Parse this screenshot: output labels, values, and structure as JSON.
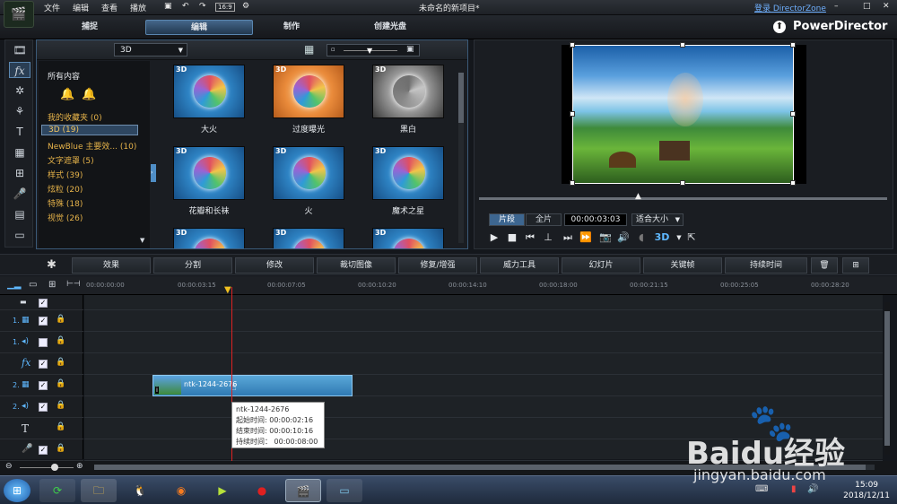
{
  "menu": {
    "file": "文件",
    "edit": "编辑",
    "view": "查看",
    "play": "播放"
  },
  "window_title": "未命名的新项目*",
  "login_link": "登录 DirectorZone",
  "tabs": {
    "capture": "捕捉",
    "edit": "编辑",
    "produce": "制作",
    "disc": "创建光盘"
  },
  "brand": "PowerDirector",
  "library": {
    "dropdown": "3D",
    "categories_header": "所有内容",
    "categories": [
      {
        "label": "我的收藏夹 (0)"
      },
      {
        "label": "3D (19)"
      },
      {
        "label": "NewBlue 主要效... (10)"
      },
      {
        "label": "文字遮罩 (5)"
      },
      {
        "label": "样式 (39)"
      },
      {
        "label": "炫粒 (20)"
      },
      {
        "label": "特殊 (18)"
      },
      {
        "label": "视觉 (26)"
      }
    ],
    "badge": "3D",
    "effects": [
      "大火",
      "过度曝光",
      "黑白",
      "花瓣和长袜",
      "火",
      "魔术之星"
    ]
  },
  "preview": {
    "clip_tab": "片段",
    "full_tab": "全片",
    "timecode": "00:00:03:03",
    "fit": "适合大小",
    "three_d": "3D"
  },
  "actions": [
    "效果",
    "分割",
    "修改",
    "裁切图像",
    "修复/增强",
    "威力工具",
    "幻灯片",
    "关键帧",
    "持续时间"
  ],
  "timeline": {
    "ticks": [
      "00:00:00:00",
      "00:00:03:15",
      "00:00:07:05",
      "00:00:10:20",
      "00:00:14:10",
      "00:00:18:00",
      "00:00:21:15",
      "00:00:25:05",
      "00:00:28:20"
    ],
    "track_labels": [
      "1.",
      "1.",
      "fx",
      "2.",
      "2.",
      "T",
      ""
    ],
    "clip_name": "ntk-1244-2676",
    "tooltip": {
      "name": "ntk-1244-2676",
      "start": "起始时间: 00:00:02:16",
      "end": "结束时间: 00:00:10:16",
      "duration": "持续时间： 00:00:08:00"
    }
  },
  "clock": {
    "time": "15:09",
    "date": "2018/12/11"
  },
  "watermark": {
    "brand": "Baidu经验",
    "url": "jingyan.baidu.com"
  }
}
